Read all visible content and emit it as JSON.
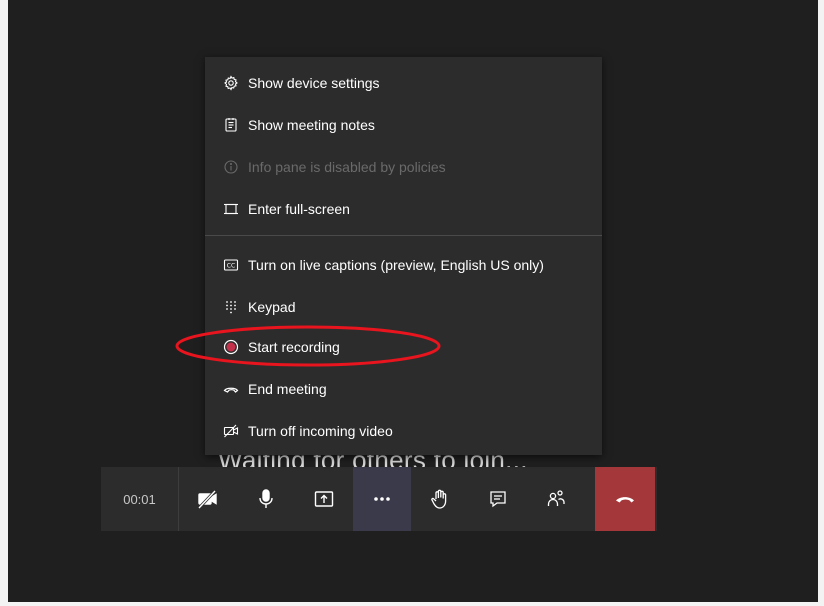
{
  "menu": {
    "items": [
      {
        "label": "Show device settings",
        "icon": "gear-icon",
        "disabled": false
      },
      {
        "label": "Show meeting notes",
        "icon": "notes-icon",
        "disabled": false
      },
      {
        "label": "Info pane is disabled by policies",
        "icon": "info-icon",
        "disabled": true
      },
      {
        "label": "Enter full-screen",
        "icon": "fullscreen-icon",
        "disabled": false
      },
      {
        "label": "Turn on live captions (preview, English US only)",
        "icon": "captions-icon",
        "disabled": false
      },
      {
        "label": "Keypad",
        "icon": "keypad-icon",
        "disabled": false
      },
      {
        "label": "Start recording",
        "icon": "record-icon",
        "disabled": false
      },
      {
        "label": "End meeting",
        "icon": "end-meeting-icon",
        "disabled": false
      },
      {
        "label": "Turn off incoming video",
        "icon": "video-off-icon",
        "disabled": false
      }
    ]
  },
  "status": {
    "waiting": "Waiting for others to join..."
  },
  "toolbar": {
    "timer": "00:01",
    "buttons": [
      "camera-off-icon",
      "microphone-icon",
      "share-screen-icon",
      "more-options-icon",
      "raise-hand-icon",
      "chat-icon",
      "participants-icon",
      "hang-up-icon"
    ]
  },
  "colors": {
    "background": "#1f1f1f",
    "panel": "#2d2c2c",
    "hangup": "#a4373a",
    "annotation": "#e8141e",
    "record_dot": "#c4314b"
  }
}
